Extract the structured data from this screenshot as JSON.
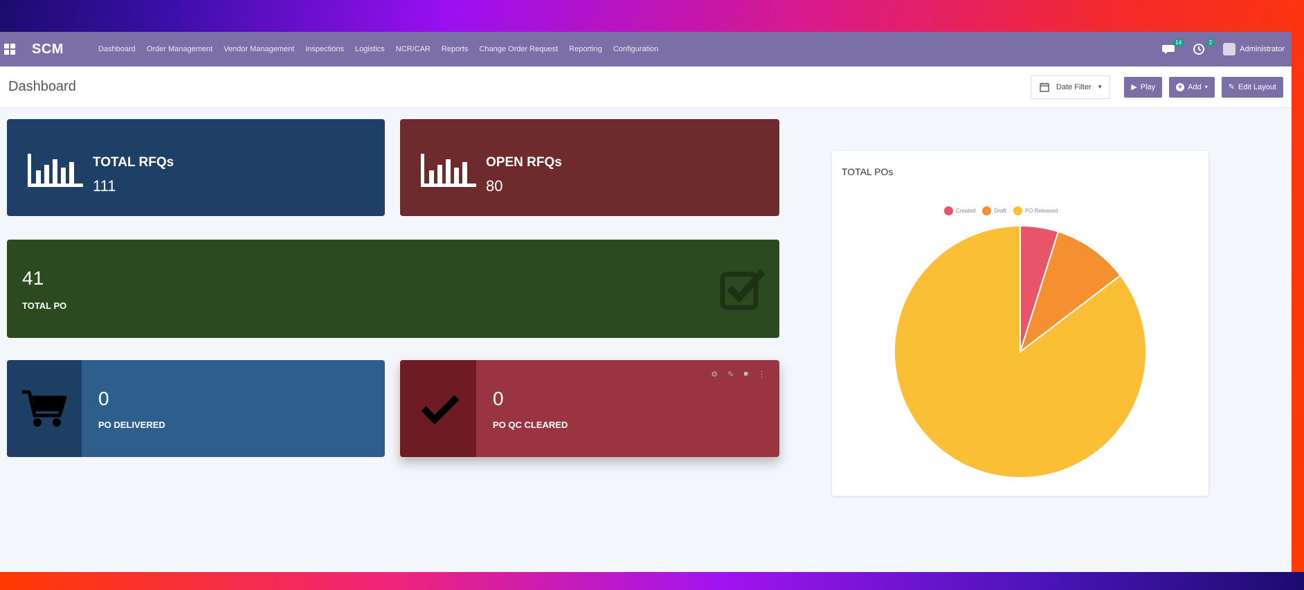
{
  "navbar": {
    "brand": "SCM",
    "menu": [
      "Dashboard",
      "Order Management",
      "Vendor Management",
      "Inspections",
      "Logistics",
      "NCR/CAR",
      "Reports",
      "Change Order Request",
      "Reporting",
      "Configuration"
    ],
    "messages_badge": "14",
    "activity_badge": "2",
    "user": "Administrator"
  },
  "control_panel": {
    "title": "Dashboard",
    "date_filter": "Date Filter",
    "play": "Play",
    "add": "Add",
    "edit_layout": "Edit Layout"
  },
  "tiles": {
    "total_rfqs": {
      "label": "TOTAL RFQs",
      "value": "111",
      "color": "#1e3f66"
    },
    "open_rfqs": {
      "label": "OPEN RFQs",
      "value": "80",
      "color": "#6e2a2c"
    },
    "total_po": {
      "label": "TOTAL PO",
      "value": "41",
      "color": "#2b4a1f"
    },
    "po_delivered": {
      "label": "PO DELIVERED",
      "value": "0",
      "color": "#2e5f8c"
    },
    "po_qc_cleared": {
      "label": "PO QC CLEARED",
      "value": "0",
      "color": "#9a3441"
    }
  },
  "chart_data": {
    "type": "pie",
    "title": "TOTAL POs",
    "categories": [
      "Created",
      "Draft",
      "PO Released"
    ],
    "values": [
      2,
      4,
      35
    ],
    "colors": [
      "#e8546a",
      "#f59030",
      "#fbbf36"
    ],
    "legend": "top"
  }
}
